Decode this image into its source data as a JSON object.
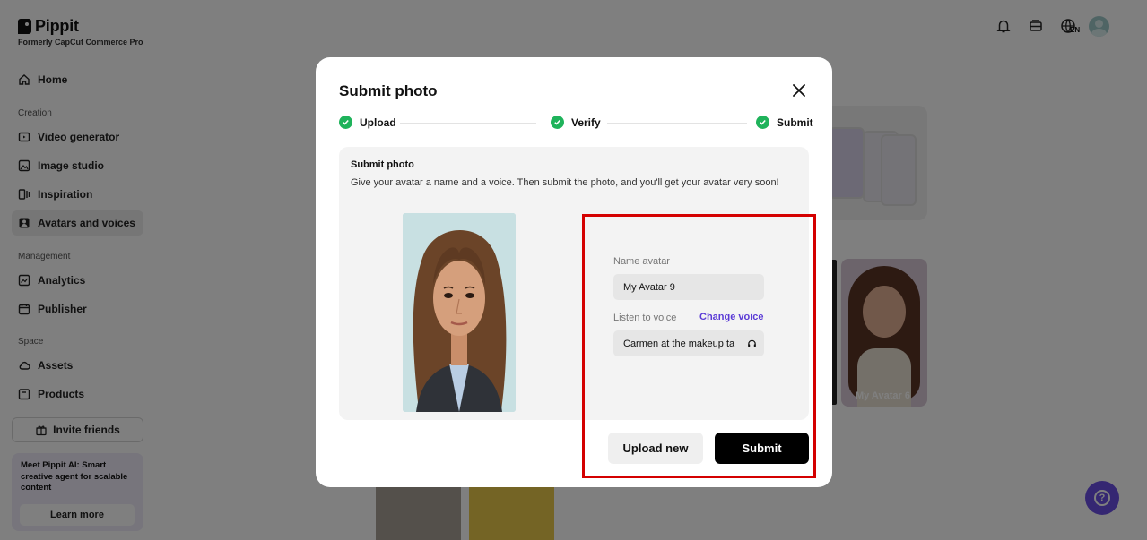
{
  "app": {
    "logo_text": "Pippit",
    "logo_sub": "Formerly CapCut Commerce Pro"
  },
  "sidebar": {
    "home": "Home",
    "section_creation": "Creation",
    "creation_items": [
      "Video generator",
      "Image studio",
      "Inspiration",
      "Avatars and voices"
    ],
    "section_management": "Management",
    "management_items": [
      "Analytics",
      "Publisher"
    ],
    "section_space": "Space",
    "space_items": [
      "Assets",
      "Products"
    ],
    "invite_label": "Invite friends",
    "promo_text": "Meet Pippit AI: Smart creative agent for scalable content",
    "promo_button": "Learn more"
  },
  "header": {
    "lang_badge": "EN",
    "icons": [
      "bell-icon",
      "storage-icon",
      "globe-icon",
      "profile-avatar"
    ]
  },
  "background": {
    "avatar_card_label": "My Avatar 6"
  },
  "modal": {
    "title": "Submit photo",
    "steps": [
      "Upload",
      "Verify",
      "Submit"
    ],
    "panel_title": "Submit photo",
    "panel_desc": "Give your avatar a name and a voice. Then submit the photo, and you'll get your avatar very soon!",
    "name_label": "Name avatar",
    "name_value": "My Avatar 9",
    "voice_label": "Listen to voice",
    "change_voice": "Change voice",
    "voice_value": "Carmen at the makeup ta",
    "upload_new": "Upload new",
    "submit": "Submit"
  },
  "colors": {
    "accent": "#5b3bd6",
    "step_check": "#1fb35b",
    "highlight": "#d40000",
    "help_button": "#6a4fe4"
  }
}
